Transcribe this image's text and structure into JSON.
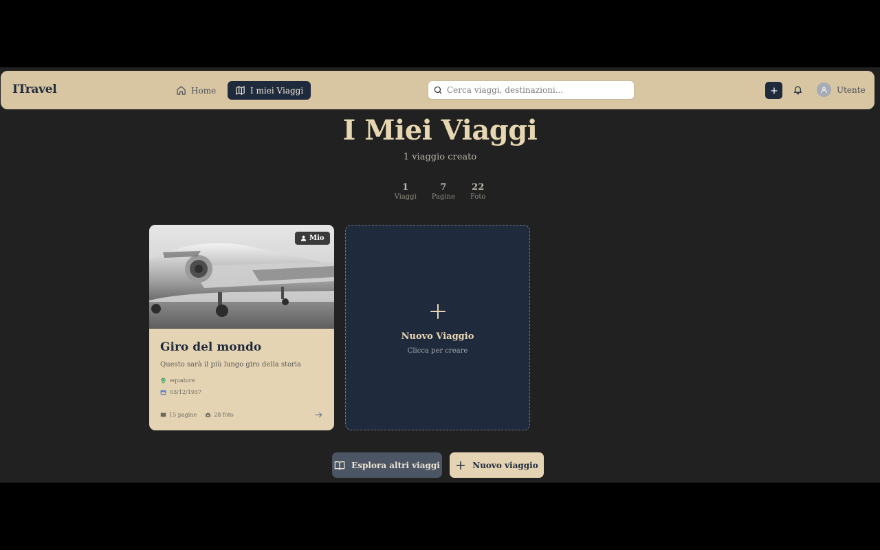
{
  "navbar": {
    "brand": "ITravel",
    "home_label": "Home",
    "trips_label": "I miei Viaggi",
    "search_placeholder": "Cerca viaggi, destinazioni...",
    "user_label": "Utente",
    "icons": [
      "home-icon",
      "map-icon",
      "search-icon",
      "plus-icon",
      "bell-icon",
      "user-icon"
    ]
  },
  "header": {
    "title": "I Miei Viaggi",
    "subtitle": "1 viaggio creato"
  },
  "stats": [
    {
      "value": "1",
      "label": "Viaggi"
    },
    {
      "value": "7",
      "label": "Pagine"
    },
    {
      "value": "22",
      "label": "Foto"
    }
  ],
  "trip": {
    "badge": "Mio",
    "title": "Giro del mondo",
    "description": "Questo sarà il più lungo giro della storia",
    "location": "equatore",
    "date": "03/12/1937",
    "pages": "15 pagine",
    "photos": "28 foto"
  },
  "new_tile": {
    "title": "Nuovo Viaggio",
    "subtitle": "Clicca per creare"
  },
  "actions": {
    "explore_label": "Esplora altri viaggi",
    "new_label": "Nuovo viaggio"
  },
  "colors": {
    "background": "#212121",
    "navbar": "#d8c6a3",
    "navy": "#1f2a3c",
    "cream": "#e5d4b3",
    "accent_gold": "#e7d6b2"
  }
}
